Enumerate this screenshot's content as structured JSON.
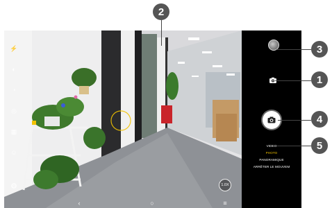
{
  "callouts": [
    "2",
    "3",
    "1",
    "4",
    "5"
  ],
  "camera": {
    "zoom_label": "1.0X",
    "modes": [
      "VIDEO",
      "PHOTO",
      "PANORAMIQUE",
      "ARRÊTER LE MOUVEM"
    ],
    "active_mode": "PHOTO",
    "accent_color": "#f2c200"
  },
  "icons": {
    "left_toolbar": [
      "flash-icon",
      "hdr-icon",
      "timer-icon",
      "filter-icon",
      "grid-icon",
      "beauty-icon"
    ],
    "settings": "gear-icon",
    "thumbnail": "gallery-thumbnail",
    "switch_camera": "switch-camera-icon",
    "shutter": "camera-icon",
    "nav": [
      "back-icon",
      "home-icon",
      "recents-icon"
    ]
  }
}
